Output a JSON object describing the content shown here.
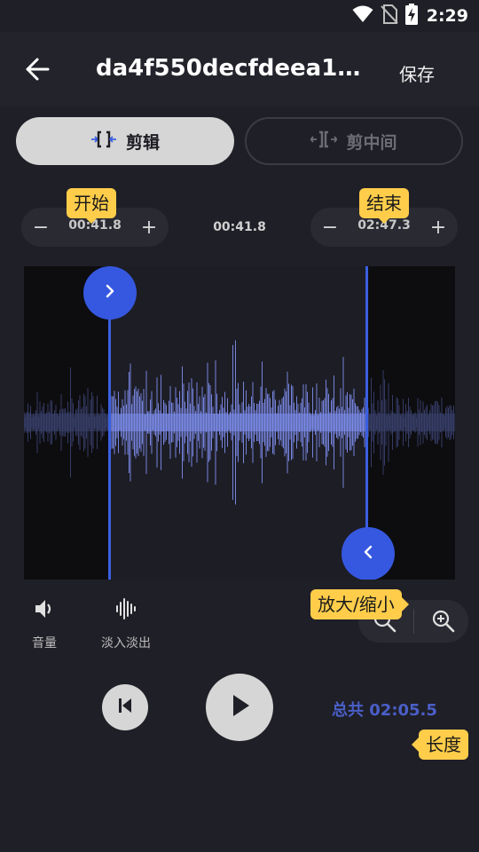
{
  "status_bar": {
    "time": "2:29"
  },
  "header": {
    "title": "da4f550decfdeea1a...",
    "save_label": "保存"
  },
  "tabs": [
    {
      "label": "剪辑",
      "selected": true
    },
    {
      "label": "剪中间",
      "selected": false
    }
  ],
  "trim": {
    "start_time": "00:41.8",
    "duration_time": "00:41.8",
    "end_time": "02:47.3",
    "minus_label": "−",
    "plus_label": "+"
  },
  "tooltips": {
    "start": "开始",
    "end": "结束",
    "zoom": "放大/缩小",
    "length": "长度"
  },
  "tools": {
    "volume_label": "音量",
    "fade_label": "淡入淡出"
  },
  "total": "总共 02:05.5",
  "colors": {
    "background": "#1f1f27",
    "accent_blue": "#3658e0",
    "waveform": "#7f8ff0",
    "tooltip": "#ffcd4a",
    "total_text": "#4a5fc8"
  }
}
